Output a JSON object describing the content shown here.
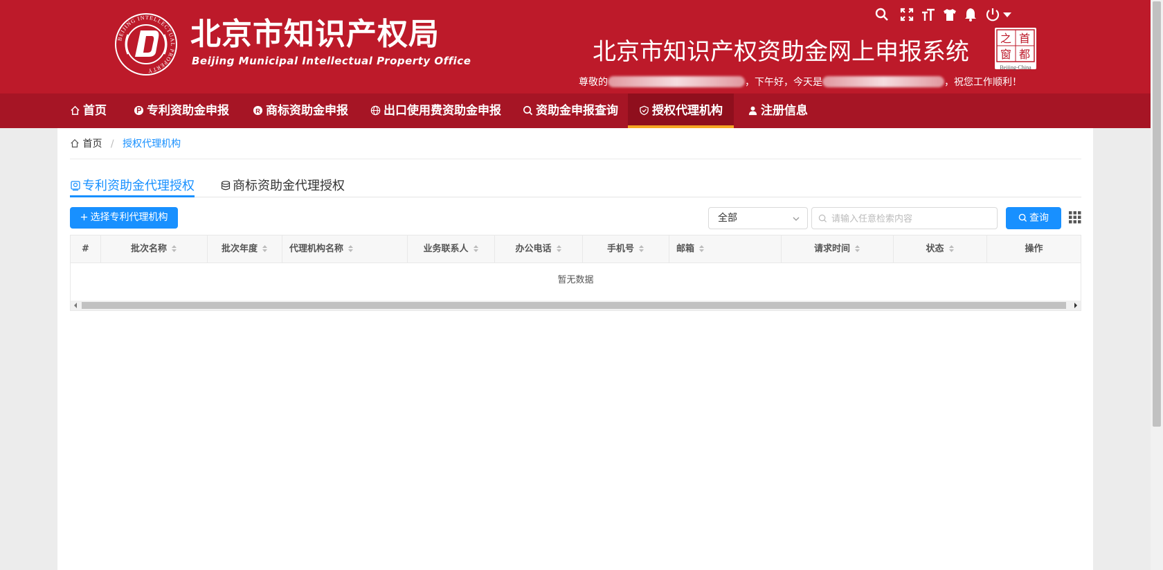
{
  "header": {
    "logo_cn": "北京市知识产权局",
    "logo_en": "Beijing Municipal Intellectual Property Office",
    "seal_text": "BEIJING INTELLECTUAL PROPERTY",
    "system_title": "北京市知识产权资助金网上申报系统",
    "capital_badge": {
      "chars": [
        "首",
        "都",
        "之",
        "窗"
      ],
      "en": "Beijing-China"
    },
    "greeting": {
      "prefix": "尊敬的",
      "middle": "，下午好，今天是",
      "suffix": "，祝您工作顺利！"
    },
    "tools": [
      "search-icon",
      "fullscreen-icon",
      "font-size-icon",
      "theme-shirt-icon",
      "bell-icon",
      "power-icon"
    ]
  },
  "nav": {
    "items": [
      {
        "label": "首页",
        "icon": "home-icon"
      },
      {
        "label": "专利资助金申报",
        "icon": "patent-icon"
      },
      {
        "label": "商标资助金申报",
        "icon": "trademark-icon"
      },
      {
        "label": "出口使用费资助金申报",
        "icon": "globe-icon"
      },
      {
        "label": "资助金申报查询",
        "icon": "search-icon"
      },
      {
        "label": "授权代理机构",
        "icon": "shield-icon"
      },
      {
        "label": "注册信息",
        "icon": "user-icon"
      }
    ],
    "active_index": 5
  },
  "breadcrumb": {
    "home": "首页",
    "sep": "/",
    "current": "授权代理机构"
  },
  "tabs": [
    {
      "label": "专利资助金代理授权",
      "active": true
    },
    {
      "label": "商标资助金代理授权",
      "active": false
    }
  ],
  "toolbar": {
    "select_agency_label": "选择专利代理机构",
    "filter_value": "全部",
    "search_placeholder": "请输入任意检索内容",
    "query_label": "查询"
  },
  "table": {
    "columns": [
      "#",
      "批次名称",
      "批次年度",
      "代理机构名称",
      "业务联系人",
      "办公电话",
      "手机号",
      "邮箱",
      "请求时间",
      "状态",
      "操作"
    ],
    "rows": [],
    "empty_text": "暂无数据"
  },
  "colors": {
    "header_red": "#bd1a2a",
    "nav_red": "#a61525",
    "nav_active": "#8f0f1d",
    "active_underline": "#f5a623",
    "primary_blue": "#1890ff"
  }
}
